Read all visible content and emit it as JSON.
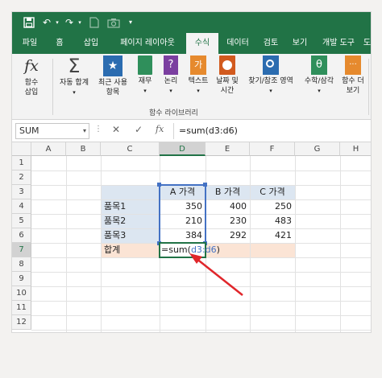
{
  "qat": {
    "undo": "↶",
    "redo": "↷"
  },
  "tabs": [
    "파일",
    "홈",
    "삽입",
    "페이지 레이아웃",
    "수식",
    "데이터",
    "검토",
    "보기",
    "개발 도구",
    "도"
  ],
  "ribbon": {
    "insert_function": [
      "함수",
      "삽입"
    ],
    "autosum": [
      "자동 합계"
    ],
    "recent": [
      "최근 사용",
      "항목"
    ],
    "financial": [
      "재무"
    ],
    "logical": [
      "논리"
    ],
    "text": [
      "텍스트"
    ],
    "datetime": [
      "날짜 및",
      "시간"
    ],
    "lookup": [
      "찾기/참조 영역"
    ],
    "math": [
      "수학/삼각"
    ],
    "more": [
      "함수 더",
      "보기"
    ],
    "group_label": "함수 라이브러리",
    "fx_glyph": "fx",
    "sigma_glyph": "Σ",
    "star_glyph": "★",
    "q_glyph": "?",
    "ga_glyph": "가",
    "theta_glyph": "θ",
    "dots_glyph": "···"
  },
  "formula_bar": {
    "name_box": "SUM",
    "cancel": "✕",
    "enter": "✓",
    "fx": "fx",
    "formula": "=sum(d3:d6)"
  },
  "columns": [
    "A",
    "B",
    "C",
    "D",
    "E",
    "F",
    "G",
    "H"
  ],
  "rows": [
    "1",
    "2",
    "3",
    "4",
    "5",
    "6",
    "7",
    "8",
    "9",
    "10",
    "11",
    "12"
  ],
  "table": {
    "headers": [
      "A 가격",
      "B 가격",
      "C 가격"
    ],
    "items": [
      {
        "label": "품목1",
        "a": "350",
        "b": "400",
        "c": "250"
      },
      {
        "label": "품목2",
        "a": "210",
        "b": "230",
        "c": "483"
      },
      {
        "label": "품목3",
        "a": "384",
        "b": "292",
        "c": "421"
      }
    ],
    "total_label": "합계",
    "formula_prefix": "=sum(",
    "formula_ref": "d3:d6",
    "formula_suffix": ")"
  },
  "colors": {
    "excel_green": "#217346",
    "range_blue": "#4472c4",
    "arrow_red": "#e0262b"
  }
}
